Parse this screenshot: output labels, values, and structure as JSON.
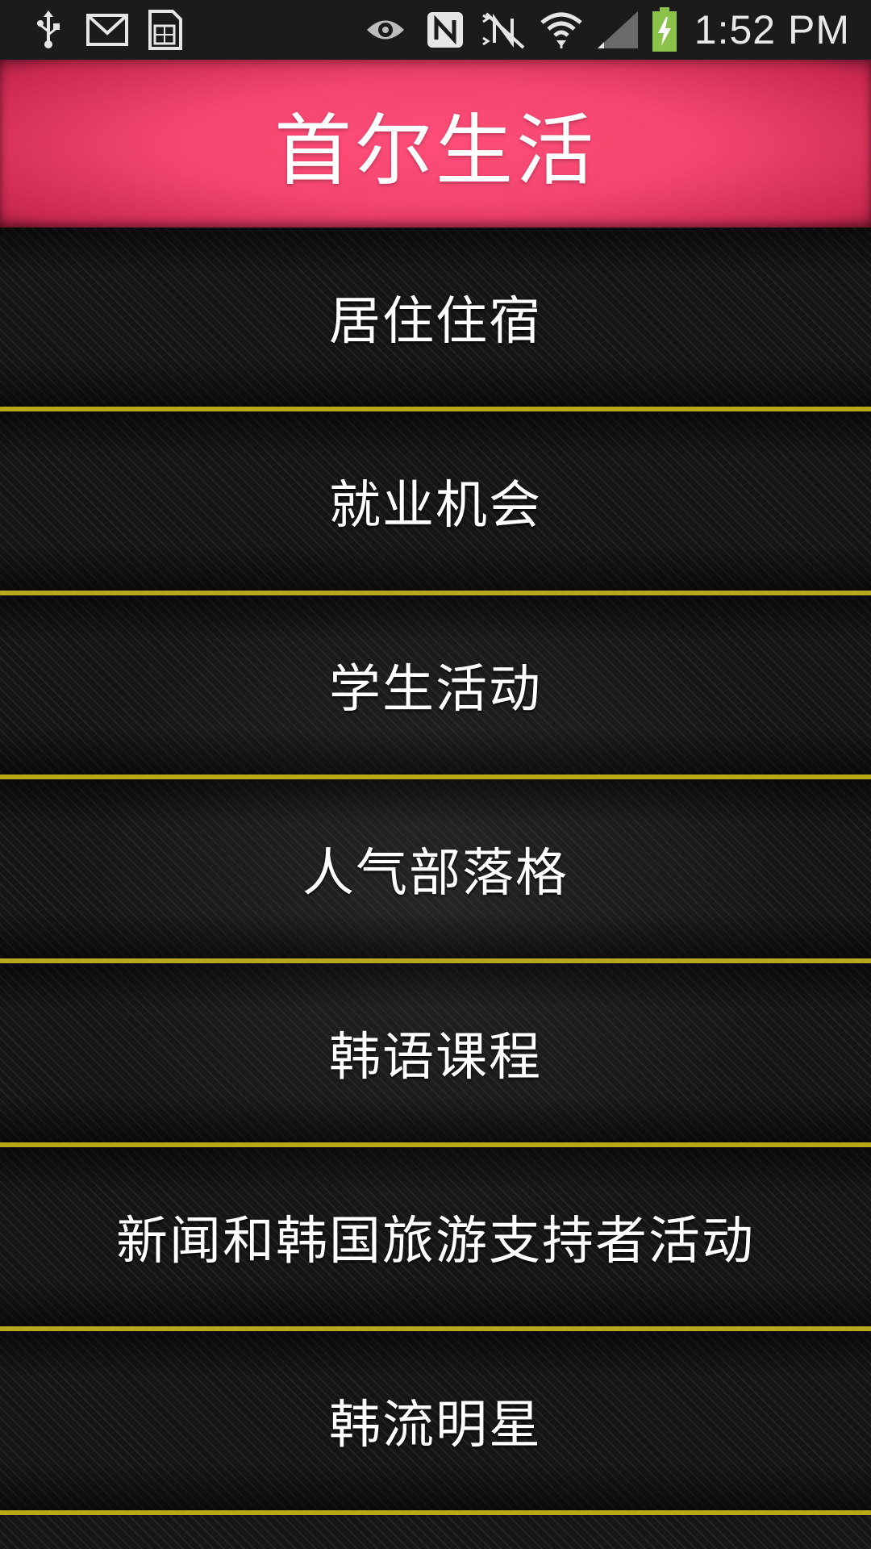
{
  "status_bar": {
    "icons": [
      "usb-icon",
      "gmail-icon",
      "sim-card-icon",
      "eye-icon",
      "nfc-icon",
      "mute-icon",
      "wifi-icon",
      "signal-icon",
      "battery-charging-icon"
    ],
    "time": "1:52 PM",
    "battery_color": "#8bc34a"
  },
  "header": {
    "title": "首尔生活",
    "color": "#ff4d78"
  },
  "menu": {
    "divider_color": "#b7a817",
    "items": [
      {
        "label": "居住住宿"
      },
      {
        "label": "就业机会"
      },
      {
        "label": "学生活动"
      },
      {
        "label": "人气部落格"
      },
      {
        "label": "韩语课程"
      },
      {
        "label": "新闻和韩国旅游支持者活动"
      },
      {
        "label": "韩流明星"
      }
    ]
  }
}
